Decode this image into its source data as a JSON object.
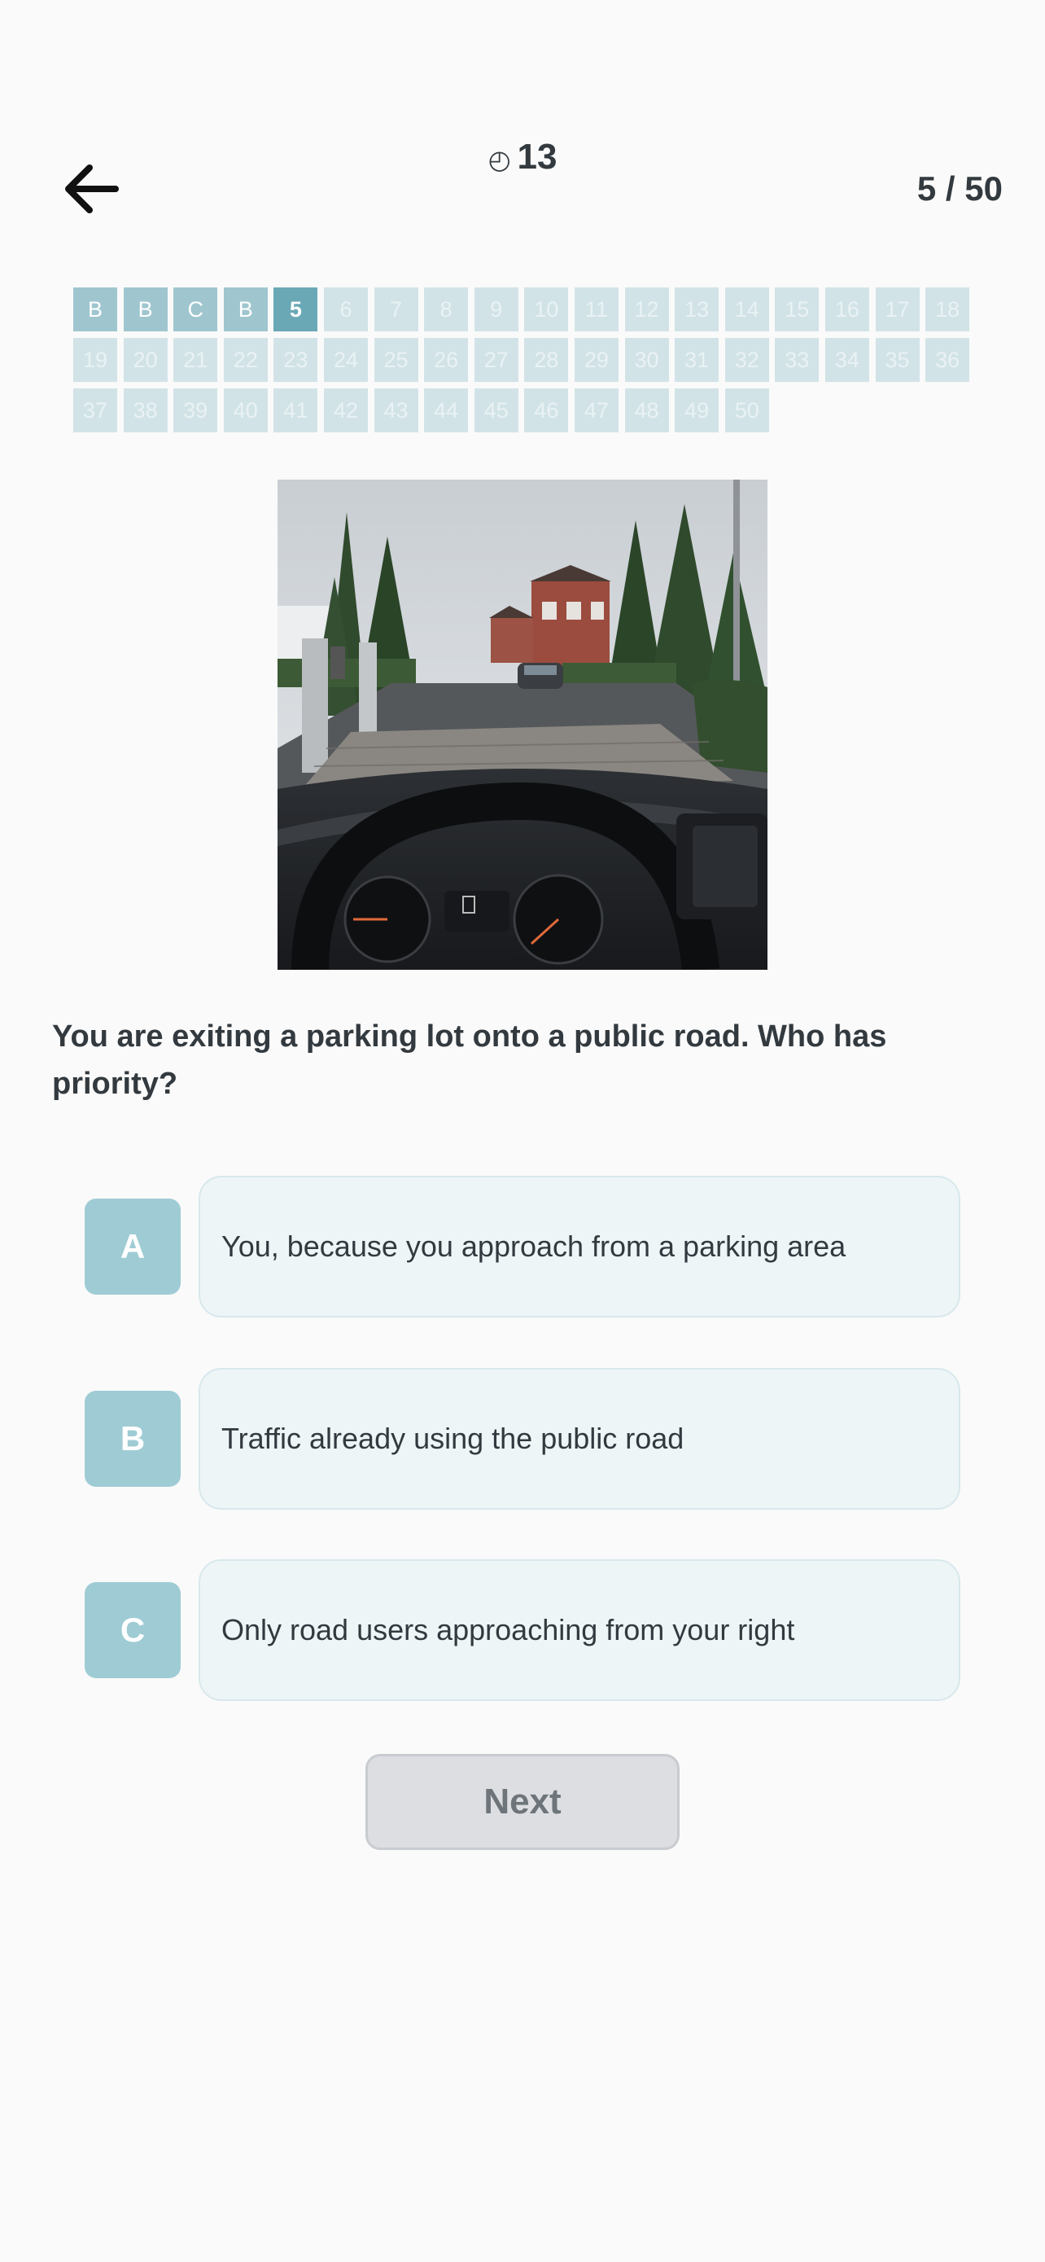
{
  "header": {
    "back_icon": "arrow-left-icon",
    "timer_icon": "clock-icon",
    "timer_glyph": "◴",
    "timer_value": "13",
    "progress_text": "5 / 50"
  },
  "question_grid": {
    "cells": [
      {
        "label": "B",
        "state": "answered"
      },
      {
        "label": "B",
        "state": "answered"
      },
      {
        "label": "C",
        "state": "answered"
      },
      {
        "label": "B",
        "state": "answered"
      },
      {
        "label": "5",
        "state": "current"
      },
      {
        "label": "6",
        "state": "pending"
      },
      {
        "label": "7",
        "state": "pending"
      },
      {
        "label": "8",
        "state": "pending"
      },
      {
        "label": "9",
        "state": "pending"
      },
      {
        "label": "10",
        "state": "pending"
      },
      {
        "label": "11",
        "state": "pending"
      },
      {
        "label": "12",
        "state": "pending"
      },
      {
        "label": "13",
        "state": "pending"
      },
      {
        "label": "14",
        "state": "pending"
      },
      {
        "label": "15",
        "state": "pending"
      },
      {
        "label": "16",
        "state": "pending"
      },
      {
        "label": "17",
        "state": "pending"
      },
      {
        "label": "18",
        "state": "pending"
      },
      {
        "label": "19",
        "state": "pending"
      },
      {
        "label": "20",
        "state": "pending"
      },
      {
        "label": "21",
        "state": "pending"
      },
      {
        "label": "22",
        "state": "pending"
      },
      {
        "label": "23",
        "state": "pending"
      },
      {
        "label": "24",
        "state": "pending"
      },
      {
        "label": "25",
        "state": "pending"
      },
      {
        "label": "26",
        "state": "pending"
      },
      {
        "label": "27",
        "state": "pending"
      },
      {
        "label": "28",
        "state": "pending"
      },
      {
        "label": "29",
        "state": "pending"
      },
      {
        "label": "30",
        "state": "pending"
      },
      {
        "label": "31",
        "state": "pending"
      },
      {
        "label": "32",
        "state": "pending"
      },
      {
        "label": "33",
        "state": "pending"
      },
      {
        "label": "34",
        "state": "pending"
      },
      {
        "label": "35",
        "state": "pending"
      },
      {
        "label": "36",
        "state": "pending"
      },
      {
        "label": "37",
        "state": "pending"
      },
      {
        "label": "38",
        "state": "pending"
      },
      {
        "label": "39",
        "state": "pending"
      },
      {
        "label": "40",
        "state": "pending"
      },
      {
        "label": "41",
        "state": "pending"
      },
      {
        "label": "42",
        "state": "pending"
      },
      {
        "label": "43",
        "state": "pending"
      },
      {
        "label": "44",
        "state": "pending"
      },
      {
        "label": "45",
        "state": "pending"
      },
      {
        "label": "46",
        "state": "pending"
      },
      {
        "label": "47",
        "state": "pending"
      },
      {
        "label": "48",
        "state": "pending"
      },
      {
        "label": "49",
        "state": "pending"
      },
      {
        "label": "50",
        "state": "pending"
      }
    ]
  },
  "question": {
    "text": "You are exiting a parking lot onto a public road. Who has priority?"
  },
  "options": [
    {
      "letter": "A",
      "text": "You, because you approach from a parking area"
    },
    {
      "letter": "B",
      "text": "Traffic already using the public road"
    },
    {
      "letter": "C",
      "text": "Only road users approaching from your right"
    }
  ],
  "next_button": {
    "label": "Next"
  },
  "colors": {
    "answered": "#9fc6cf",
    "current": "#6aa8b6",
    "pending": "#d2e3e7",
    "option_letter_bg": "#9fccd4",
    "option_box_bg": "#eef5f7",
    "next_disabled_bg": "#dcdee1"
  }
}
